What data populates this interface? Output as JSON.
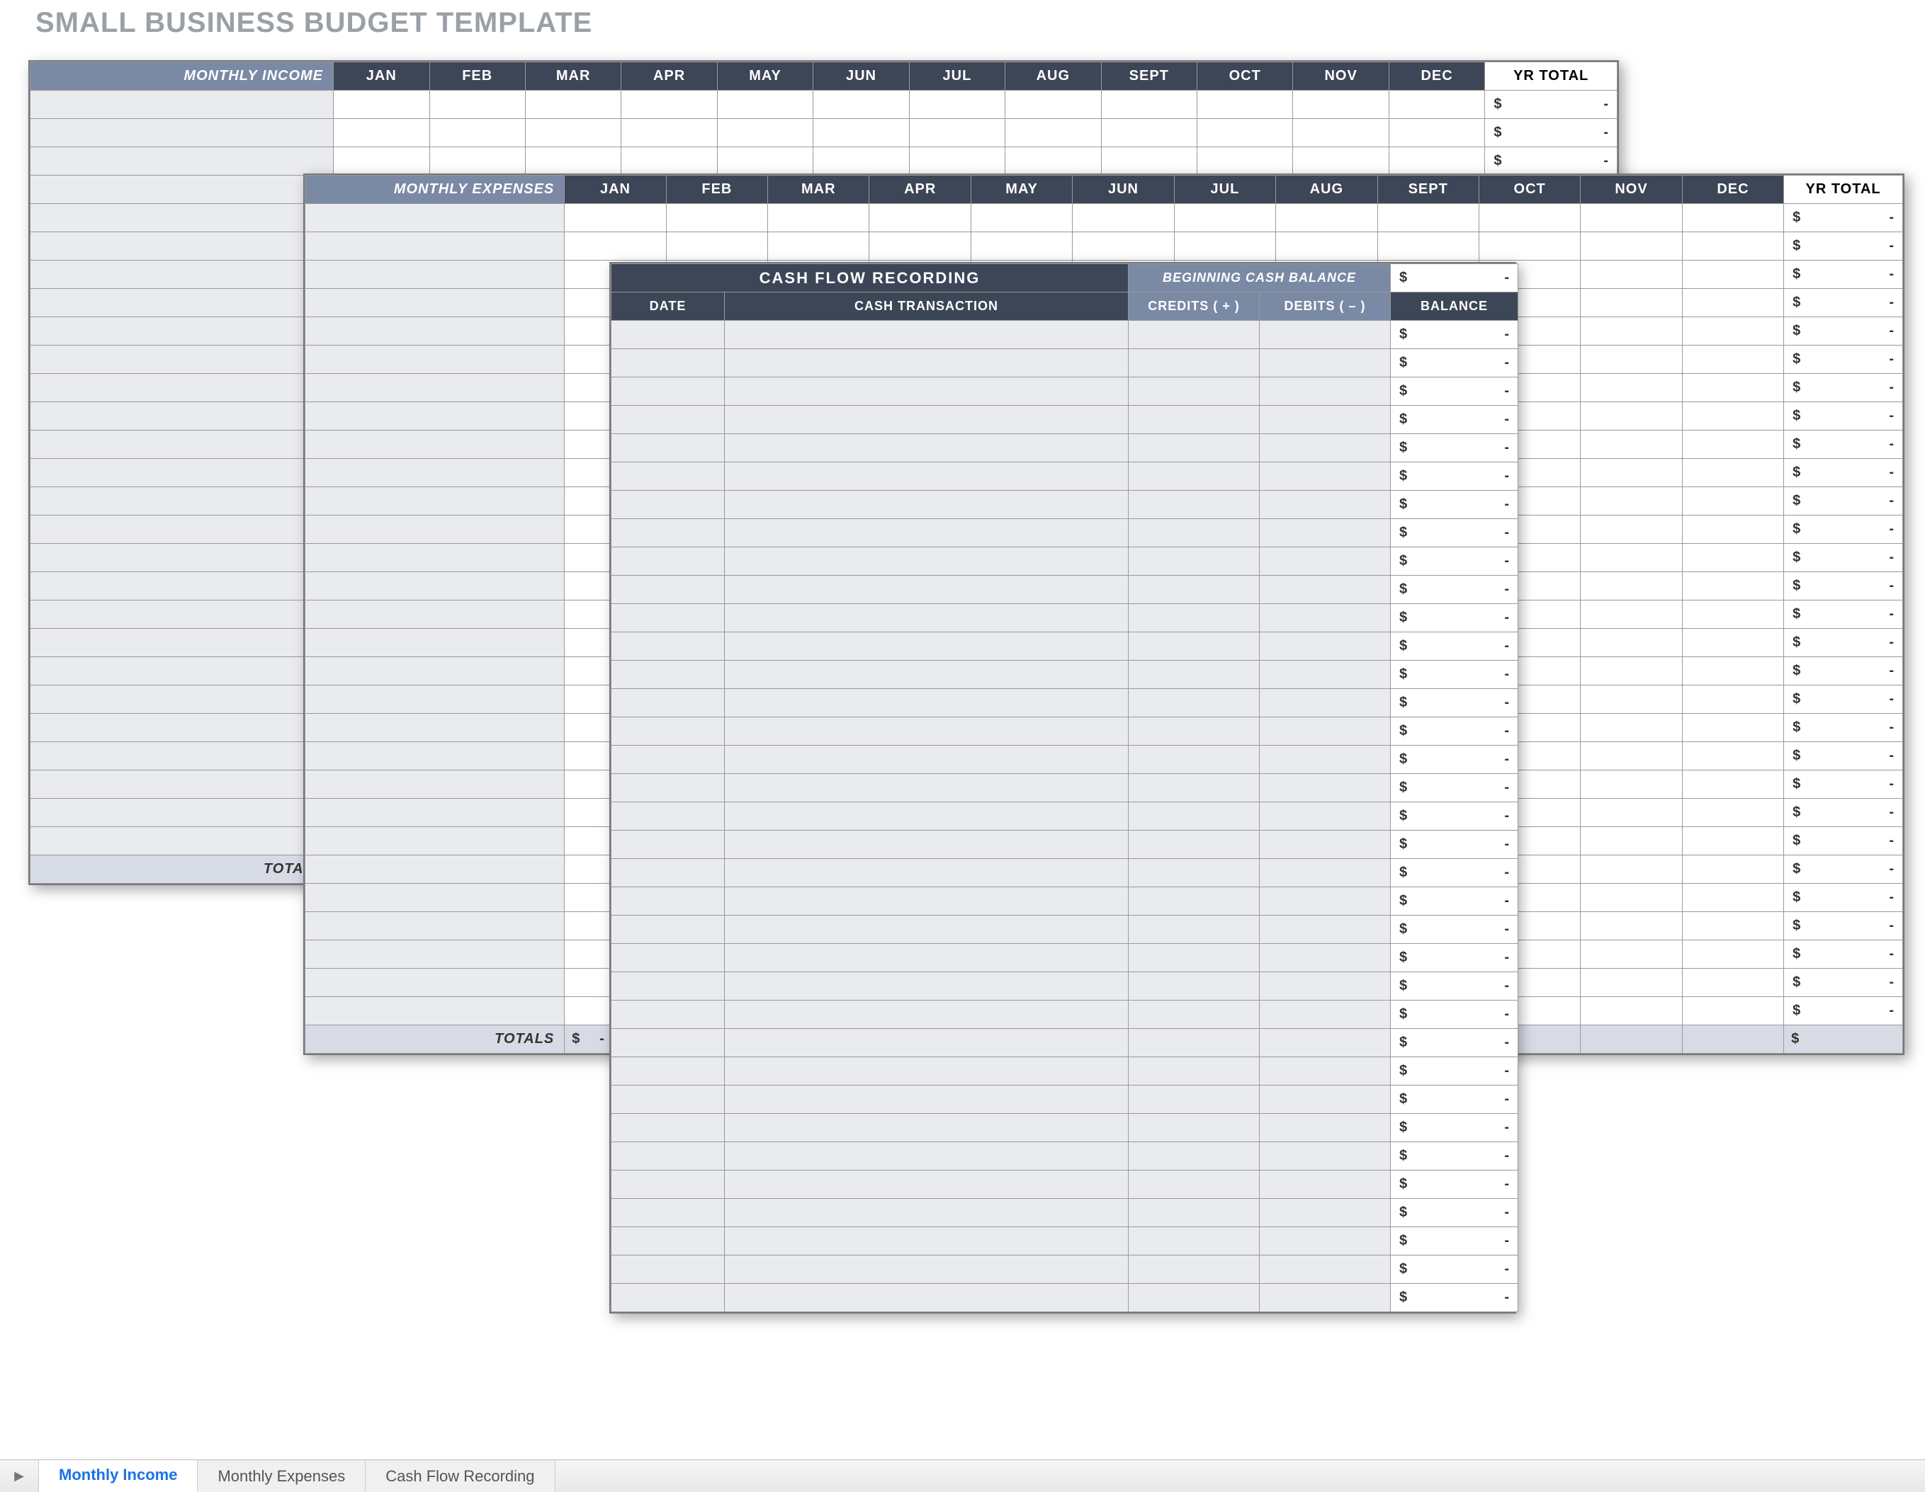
{
  "title": "SMALL BUSINESS BUDGET TEMPLATE",
  "months": [
    "JAN",
    "FEB",
    "MAR",
    "APR",
    "MAY",
    "JUN",
    "JUL",
    "AUG",
    "SEPT",
    "OCT",
    "NOV",
    "DEC"
  ],
  "yr_total": "YR TOTAL",
  "totals": "TOTALS",
  "currency": "$",
  "dash": "-",
  "income": {
    "header": "MONTHLY INCOME",
    "rows": 27,
    "yr_value": "$"
  },
  "expenses": {
    "header": "MONTHLY EXPENSES",
    "rows": 29,
    "yr_value": "$"
  },
  "cashflow": {
    "title": "CASH FLOW RECORDING",
    "begin_label": "BEGINNING CASH BALANCE",
    "cols": {
      "date": "DATE",
      "trans": "CASH TRANSACTION",
      "credits": "CREDITS ( + )",
      "debits": "DEBITS ( – )",
      "balance": "BALANCE"
    },
    "rows": 35,
    "balance_value": "$"
  },
  "tabs": {
    "nav_icon": "▶",
    "items": [
      "Monthly Income",
      "Monthly Expenses",
      "Cash Flow Recording"
    ],
    "active": 0
  }
}
